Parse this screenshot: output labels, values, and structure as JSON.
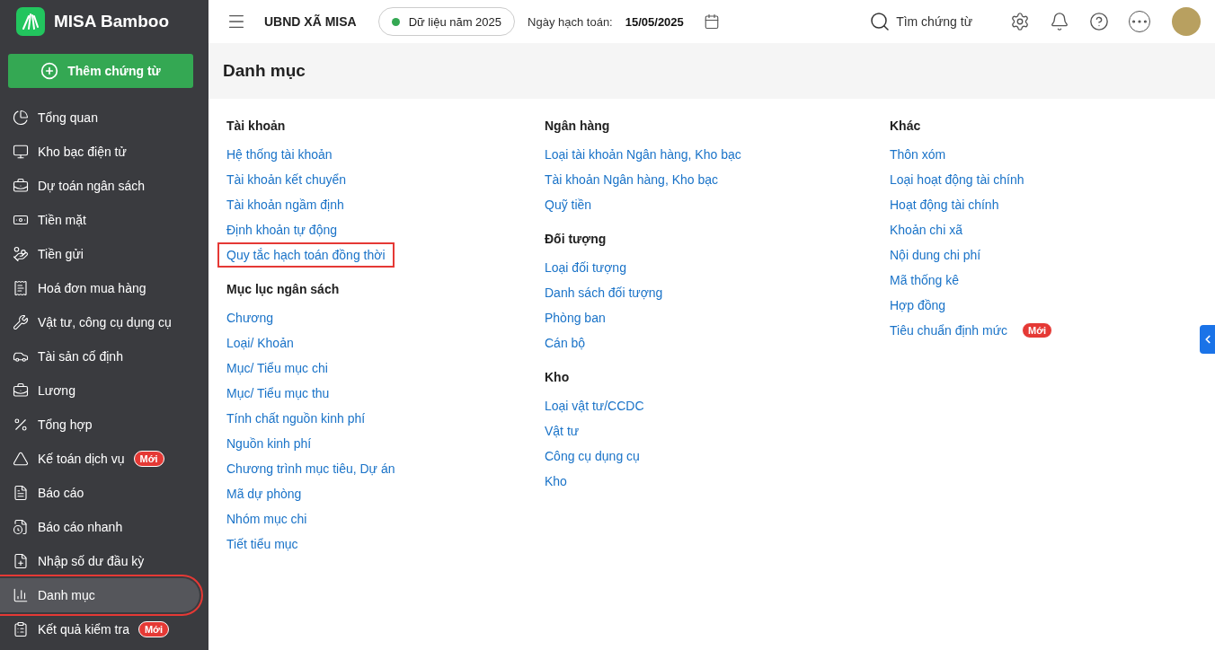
{
  "app": {
    "name": "MISA Bamboo"
  },
  "add_button": {
    "label": "Thêm chứng từ"
  },
  "sidebar": {
    "items": [
      {
        "label": "Tổng quan",
        "selected": false,
        "highlighted": false
      },
      {
        "label": "Kho bạc điện tử",
        "selected": false,
        "highlighted": false
      },
      {
        "label": "Dự toán ngân sách",
        "selected": false,
        "highlighted": false
      },
      {
        "label": "Tiền mặt",
        "selected": false,
        "highlighted": false
      },
      {
        "label": "Tiền gửi",
        "selected": false,
        "highlighted": false
      },
      {
        "label": "Hoá đơn mua hàng",
        "selected": false,
        "highlighted": false
      },
      {
        "label": "Vật tư, công cụ dụng cụ",
        "selected": false,
        "highlighted": false
      },
      {
        "label": "Tài sản cố định",
        "selected": false,
        "highlighted": false
      },
      {
        "label": "Lương",
        "selected": false,
        "highlighted": false
      },
      {
        "label": "Tổng hợp",
        "selected": false,
        "highlighted": false
      },
      {
        "label": "Kế toán dịch vụ",
        "badge": "Mới",
        "selected": false,
        "highlighted": false
      },
      {
        "label": "Báo cáo",
        "selected": false,
        "highlighted": false
      },
      {
        "label": "Báo cáo nhanh",
        "selected": false,
        "highlighted": false
      },
      {
        "label": "Nhập số dư đầu kỳ",
        "selected": false,
        "highlighted": false
      },
      {
        "label": "Danh mục",
        "selected": true,
        "highlighted": true
      },
      {
        "label": "Kết quả kiểm tra",
        "badge": "Mới",
        "selected": false,
        "highlighted": false
      }
    ]
  },
  "header": {
    "organization": "UBND XÃ MISA",
    "data_year": "Dữ liệu năm 2025",
    "date_label": "Ngày hạch toán:",
    "date": "15/05/2025",
    "search": "Tìm chứng từ"
  },
  "page": {
    "title": "Danh mục",
    "columns": [
      [
        {
          "title": "Tài khoản",
          "items": [
            {
              "label": "Hệ thống tài khoản",
              "highlighted": false
            },
            {
              "label": "Tài khoản kết chuyển",
              "highlighted": false
            },
            {
              "label": "Tài khoản ngầm định",
              "highlighted": false
            },
            {
              "label": "Định khoản tự động",
              "highlighted": false
            },
            {
              "label": "Quy tắc hạch toán đồng thời",
              "highlighted": true
            }
          ]
        },
        {
          "title": "Mục lục ngân sách",
          "items": [
            {
              "label": "Chương",
              "highlighted": false
            },
            {
              "label": "Loại/ Khoản",
              "highlighted": false
            },
            {
              "label": "Mục/ Tiểu mục chi",
              "highlighted": false
            },
            {
              "label": "Mục/ Tiểu mục thu",
              "highlighted": false
            },
            {
              "label": "Tính chất nguồn kinh phí",
              "highlighted": false
            },
            {
              "label": "Nguồn kinh phí",
              "highlighted": false
            },
            {
              "label": "Chương trình mục tiêu, Dự án",
              "highlighted": false
            },
            {
              "label": "Mã dự phòng",
              "highlighted": false
            },
            {
              "label": "Nhóm mục chi",
              "highlighted": false
            },
            {
              "label": "Tiết tiểu mục",
              "highlighted": false
            }
          ]
        }
      ],
      [
        {
          "title": "Ngân hàng",
          "items": [
            {
              "label": "Loại tài khoản Ngân hàng, Kho bạc",
              "highlighted": false
            },
            {
              "label": "Tài khoản Ngân hàng, Kho bạc",
              "highlighted": false
            },
            {
              "label": "Quỹ tiền",
              "highlighted": false
            }
          ]
        },
        {
          "title": "Đối tượng",
          "items": [
            {
              "label": "Loại đối tượng",
              "highlighted": false
            },
            {
              "label": "Danh sách đối tượng",
              "highlighted": false
            },
            {
              "label": "Phòng ban",
              "highlighted": false
            },
            {
              "label": "Cán bộ",
              "highlighted": false
            }
          ]
        },
        {
          "title": "Kho",
          "items": [
            {
              "label": "Loại vật tư/CCDC",
              "highlighted": false
            },
            {
              "label": "Vật tư",
              "highlighted": false
            },
            {
              "label": "Công cụ dụng cụ",
              "highlighted": false
            },
            {
              "label": "Kho",
              "highlighted": false
            }
          ]
        }
      ],
      [
        {
          "title": "Khác",
          "items": [
            {
              "label": "Thôn xóm",
              "highlighted": false
            },
            {
              "label": "Loại hoạt động tài chính",
              "highlighted": false
            },
            {
              "label": "Hoạt động tài chính",
              "highlighted": false
            },
            {
              "label": "Khoản chi xã",
              "highlighted": false
            },
            {
              "label": "Nội dung chi phí",
              "highlighted": false
            },
            {
              "label": "Mã thống kê",
              "highlighted": false
            },
            {
              "label": "Hợp đồng",
              "highlighted": false
            },
            {
              "label": "Tiêu chuẩn định mức",
              "badge": "Mới",
              "highlighted": false
            }
          ]
        }
      ]
    ]
  }
}
